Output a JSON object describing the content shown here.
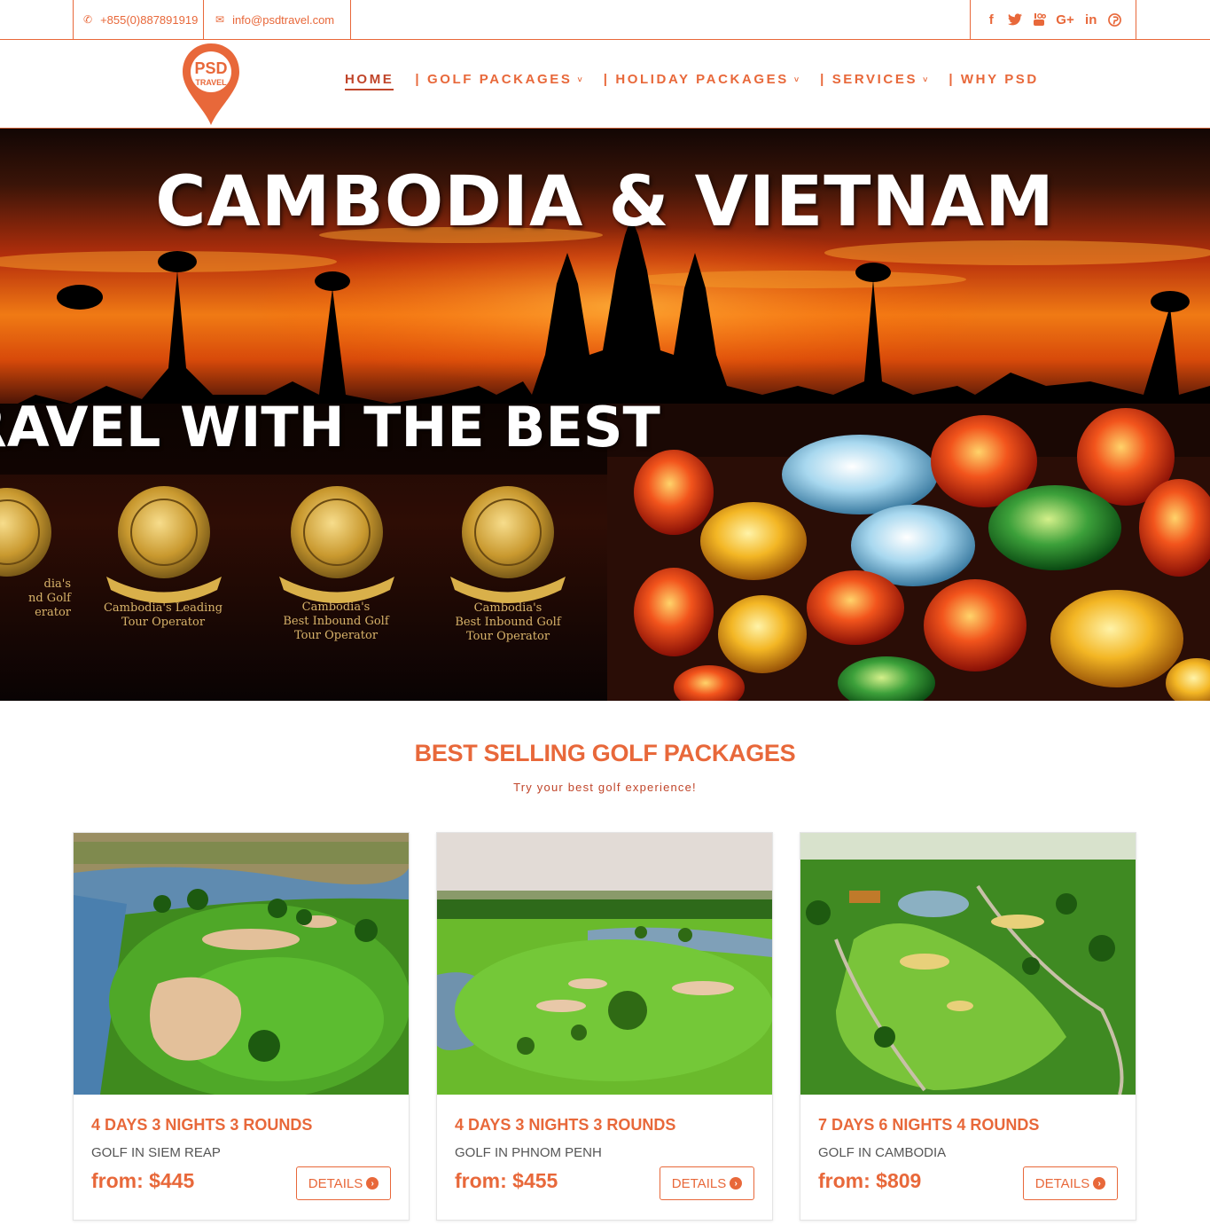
{
  "topbar": {
    "phone": "+855(0)887891919",
    "email": "info@psdtravel.com",
    "social": [
      {
        "icon": "facebook-icon",
        "glyph": "f"
      },
      {
        "icon": "twitter-icon",
        "glyph": "🐦"
      },
      {
        "icon": "youtube-icon",
        "glyph": "▶"
      },
      {
        "icon": "google-plus-icon",
        "glyph": "G+"
      },
      {
        "icon": "linkedin-icon",
        "glyph": "in"
      },
      {
        "icon": "pinterest-icon",
        "glyph": "℗"
      }
    ]
  },
  "logo": {
    "line1": "PSD",
    "line2": "TRAVEL"
  },
  "nav": {
    "home": "HOME",
    "golf": "| GOLF PACKAGES",
    "holiday": "| HOLIDAY PACKAGES",
    "services": "| SERVICES",
    "why": "| WHY PSD",
    "chevron": "˅"
  },
  "hero": {
    "title": "CAMBODIA & VIETNAM",
    "subtitle": "RAVEL WITH THE BEST",
    "awards": [
      {
        "text": "dia's\nnd Golf\nerator"
      },
      {
        "text": "Cambodia's Leading\nTour Operator"
      },
      {
        "text": "Cambodia's\nBest Inbound Golf\nTour Operator"
      },
      {
        "text": "Cambodia's\nBest Inbound Golf\nTour Operator"
      }
    ]
  },
  "section": {
    "title": "BEST SELLING GOLF PACKAGES",
    "subtitle": "Try your best golf experience!"
  },
  "cards": [
    {
      "title": "4 DAYS 3 NIGHTS 3 ROUNDS",
      "location": "GOLF IN SIEM REAP",
      "price": "from: $445",
      "button": "DETAILS"
    },
    {
      "title": "4 DAYS 3 NIGHTS 3 ROUNDS",
      "location": "GOLF IN PHNOM PENH",
      "price": "from: $455",
      "button": "DETAILS"
    },
    {
      "title": "7 DAYS 6 NIGHTS 4 ROUNDS",
      "location": "GOLF IN CAMBODIA",
      "price": "from: $809",
      "button": "DETAILS"
    }
  ],
  "colors": {
    "accent": "#e8683a",
    "accent_dark": "#c0452a",
    "text_gray": "#555555"
  }
}
